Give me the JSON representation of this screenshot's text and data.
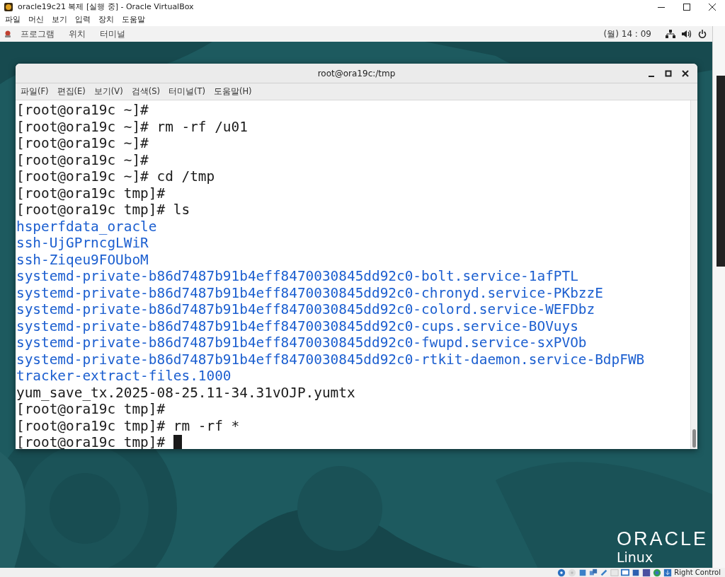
{
  "window": {
    "title": "oracle19c21 복제 [실행 중] - Oracle VirtualBox"
  },
  "menu": [
    "파일",
    "머신",
    "보기",
    "입력",
    "장치",
    "도움말"
  ],
  "top_bar": {
    "menus": [
      "프로그램",
      "위치",
      "터미널"
    ],
    "clock": "(월) 14 : 09"
  },
  "terminal": {
    "title": "root@ora19c:/tmp",
    "menu": [
      "파일(F)",
      "편집(E)",
      "보기(V)",
      "검색(S)",
      "터미널(T)",
      "도움말(H)"
    ],
    "lines": [
      {
        "kind": "prompt",
        "text": "[root@ora19c ~]#"
      },
      {
        "kind": "prompt",
        "text": "[root@ora19c ~]# rm -rf /u01"
      },
      {
        "kind": "prompt",
        "text": "[root@ora19c ~]#"
      },
      {
        "kind": "prompt",
        "text": "[root@ora19c ~]#"
      },
      {
        "kind": "prompt",
        "text": "[root@ora19c ~]# cd /tmp"
      },
      {
        "kind": "prompt",
        "text": "[root@ora19c tmp]#"
      },
      {
        "kind": "prompt",
        "text": "[root@ora19c tmp]# ls"
      },
      {
        "kind": "dir",
        "text": "hsperfdata_oracle"
      },
      {
        "kind": "dir",
        "text": "ssh-UjGPrncgLWiR"
      },
      {
        "kind": "dir",
        "text": "ssh-Ziqeu9FOUboM"
      },
      {
        "kind": "dir",
        "text": "systemd-private-b86d7487b91b4eff8470030845dd92c0-bolt.service-1afPTL"
      },
      {
        "kind": "dir",
        "text": "systemd-private-b86d7487b91b4eff8470030845dd92c0-chronyd.service-PKbzzE"
      },
      {
        "kind": "dir",
        "text": "systemd-private-b86d7487b91b4eff8470030845dd92c0-colord.service-WEFDbz"
      },
      {
        "kind": "dir",
        "text": "systemd-private-b86d7487b91b4eff8470030845dd92c0-cups.service-BOVuys"
      },
      {
        "kind": "dir",
        "text": "systemd-private-b86d7487b91b4eff8470030845dd92c0-fwupd.service-sxPVOb"
      },
      {
        "kind": "dir",
        "text": "systemd-private-b86d7487b91b4eff8470030845dd92c0-rtkit-daemon.service-BdpFWB"
      },
      {
        "kind": "dir",
        "text": "tracker-extract-files.1000"
      },
      {
        "kind": "file",
        "text": "yum_save_tx.2025-08-25.11-34.31vOJP.yumtx"
      },
      {
        "kind": "prompt",
        "text": "[root@ora19c tmp]#"
      },
      {
        "kind": "prompt",
        "text": "[root@ora19c tmp]# rm -rf *"
      },
      {
        "kind": "prompt",
        "text": "[root@ora19c tmp]# "
      }
    ]
  },
  "desktop": {
    "logo": "ORACLE",
    "logo_sub": "Linux"
  },
  "status_bar": {
    "host_key": "Right Control"
  }
}
